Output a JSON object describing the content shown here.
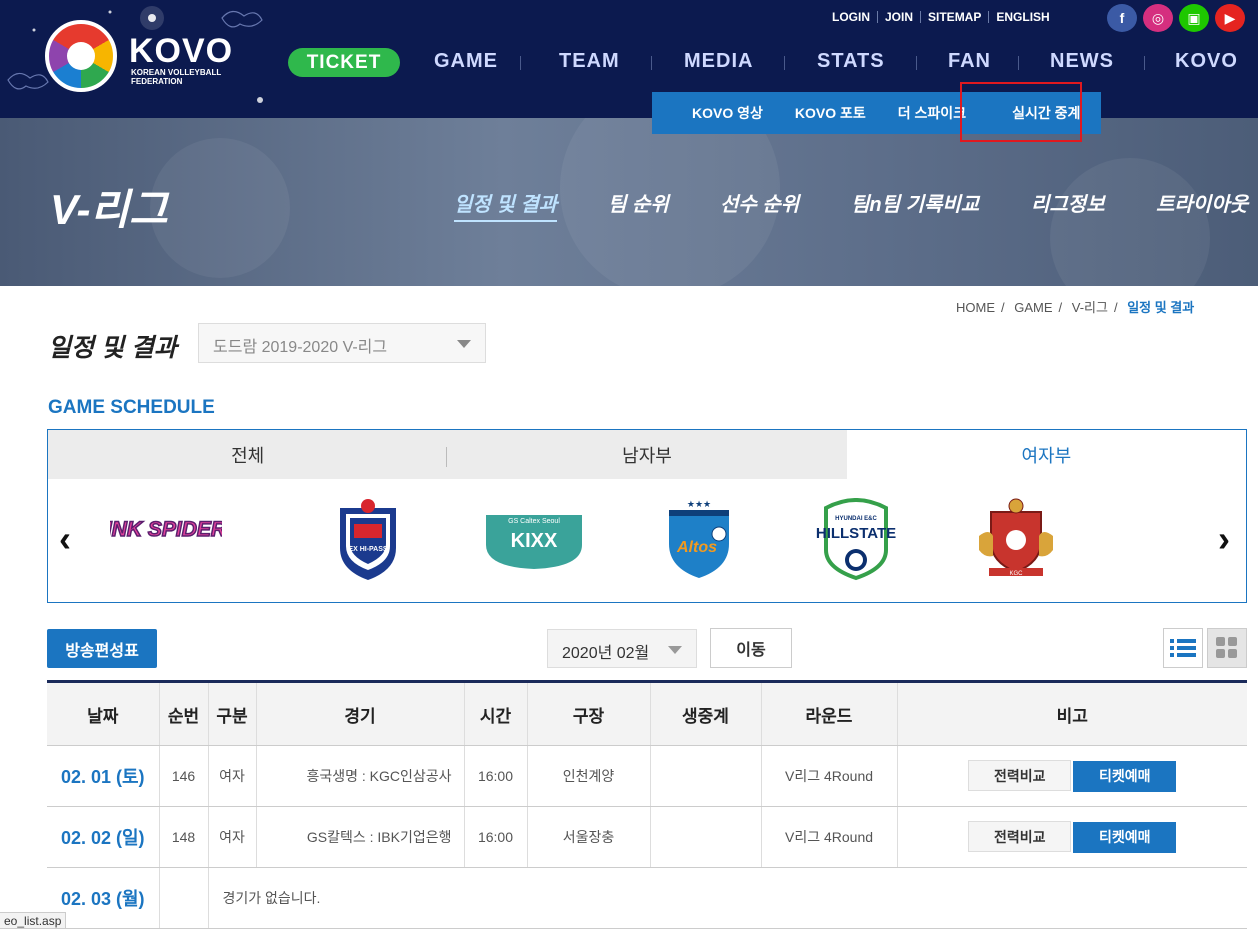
{
  "header": {
    "logo_text": "KOVO",
    "logo_sub": "KOREAN VOLLEYBALL FEDERATION",
    "util_links": [
      "LOGIN",
      "JOIN",
      "SITEMAP",
      "ENGLISH"
    ],
    "social": [
      {
        "icon": "facebook-icon",
        "glyph": "f",
        "color": "#3b5aa5"
      },
      {
        "icon": "instagram-icon",
        "glyph": "◎",
        "color": "#d52f7f"
      },
      {
        "icon": "naver-tv-icon",
        "glyph": "▣",
        "color": "#1ec800"
      },
      {
        "icon": "youtube-icon",
        "glyph": "▶",
        "color": "#e52420"
      }
    ],
    "ticket": "TICKET",
    "nav": [
      "GAME",
      "TEAM",
      "MEDIA",
      "STATS",
      "FAN",
      "NEWS",
      "KOVO"
    ],
    "submenu": [
      "KOVO 영상",
      "KOVO 포토",
      "더 스파이크",
      "실시간 중계"
    ]
  },
  "banner": {
    "title": "V-리그",
    "tabs": [
      "일정 및 결과",
      "팀 순위",
      "선수 순위",
      "팀n팀 기록비교",
      "리그정보",
      "트라이아웃"
    ]
  },
  "breadcrumb": [
    "HOME",
    "GAME",
    "V-리그",
    "일정 및 결과"
  ],
  "page_title": "일정 및 결과",
  "season_select": "도드람 2019-2020 V-리그",
  "section_title": "GAME SCHEDULE",
  "team_tabs": [
    "전체",
    "남자부",
    "여자부"
  ],
  "teams": [
    {
      "name": "PINK SPIDERS"
    },
    {
      "name": "EX HI-PASS"
    },
    {
      "name": "GS Caltex Seoul KIXX",
      "sub": "GS Caltex Seoul",
      "main": "KIXX"
    },
    {
      "name": "Altos"
    },
    {
      "name": "HYUNDAI E&C HILLSTATE",
      "sub": "HYUNDAI E&C",
      "main": "HILLSTATE"
    },
    {
      "name": "KGC"
    }
  ],
  "controls": {
    "broadcast": "방송편성표",
    "month": "2020년 02월",
    "go": "이동"
  },
  "table": {
    "headers": [
      "날짜",
      "순번",
      "구분",
      "경기",
      "시간",
      "구장",
      "생중계",
      "라운드",
      "비고"
    ],
    "rows": [
      {
        "date": "02. 01 (토)",
        "no": "146",
        "div": "여자",
        "match": "흥국생명  :  KGC인삼공사",
        "time": "16:00",
        "venue": "인천계양",
        "live": "",
        "round": "V리그 4Round",
        "compare": "전력비교",
        "ticket": "티켓예매"
      },
      {
        "date": "02. 02 (일)",
        "no": "148",
        "div": "여자",
        "match": "GS칼텍스  :  IBK기업은행",
        "time": "16:00",
        "venue": "서울장충",
        "live": "",
        "round": "V리그 4Round",
        "compare": "전력비교",
        "ticket": "티켓예매"
      },
      {
        "date": "02. 03 (월)",
        "message": "경기가 없습니다."
      }
    ]
  },
  "statusbar": "eo_list.asp"
}
